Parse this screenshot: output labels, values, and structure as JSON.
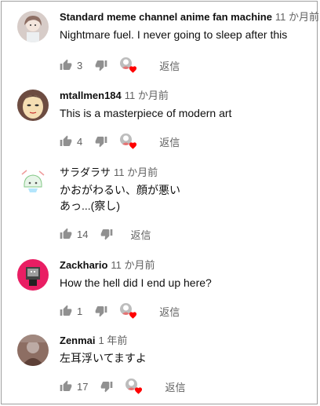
{
  "comments": [
    {
      "author": "Standard meme channel anime fan machine",
      "time": "11 か月前",
      "text_lines": [
        "Nightmare fuel. I never going to sleep after this"
      ],
      "likes": "3",
      "reply_label": "返信",
      "avatar_icon": "avatar-anime-girl-icon"
    },
    {
      "author": "mtallmen184",
      "time": "11 か月前",
      "text_lines": [
        "This is a masterpiece of modern art"
      ],
      "likes": "4",
      "reply_label": "返信",
      "avatar_icon": "avatar-face-drawing-icon"
    },
    {
      "author": "サラダラサ",
      "time": "11 か月前",
      "text_lines": [
        "かおがわるい、顔が悪い",
        "あっ...(察し)"
      ],
      "likes": "14",
      "reply_label": "返信",
      "avatar_icon": "avatar-chibi-drawing-icon"
    },
    {
      "author": "Zackhario",
      "time": "11 か月前",
      "text_lines": [
        "How the hell did I end up here?"
      ],
      "likes": "1",
      "reply_label": "返信",
      "avatar_icon": "avatar-red-robot-icon"
    },
    {
      "author": "Zenmai",
      "time": "1 年前",
      "text_lines": [
        "左耳浮いてますよ"
      ],
      "likes": "17",
      "reply_label": "返信",
      "avatar_icon": "avatar-photo-icon"
    }
  ],
  "colors": {
    "text": "#0f0f0f",
    "secondary": "#606060",
    "heart": "#ff0000"
  },
  "icons": {
    "like": "thumb-up-icon",
    "dislike": "thumb-down-icon",
    "creator_heart": "creator-heart-icon"
  }
}
